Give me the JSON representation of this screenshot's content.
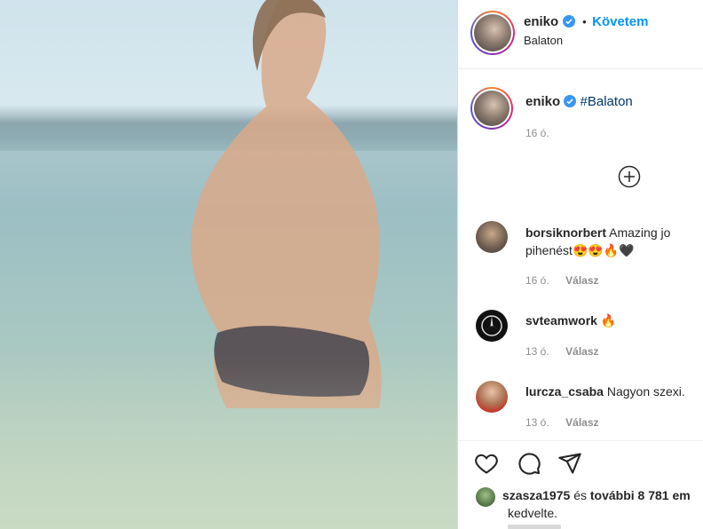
{
  "post": {
    "username": "eniko",
    "location": "Balaton",
    "follow_label": "Követem",
    "dot": "•"
  },
  "caption": {
    "username": "eniko",
    "hashtag": "#Balaton",
    "time": "16 ó."
  },
  "comments": [
    {
      "username": "borsiknorbert",
      "text_line1": "Amazing jo",
      "text_line2": "pihenést",
      "emojis": "😍😍🔥🖤",
      "time": "16 ó.",
      "reply": "Válasz"
    },
    {
      "username": "svteamwork",
      "text": "🔥",
      "time": "13 ó.",
      "reply": "Válasz"
    },
    {
      "username": "lurcza_csaba",
      "text": "Nagyon szexi.",
      "time": "13 ó.",
      "reply": "Válasz"
    }
  ],
  "likes": {
    "user": "szasza1975",
    "connector": "és",
    "others": "további 8 781 em",
    "suffix": "kedvelte."
  },
  "colors": {
    "accent": "#0095f6",
    "text": "#262626",
    "muted": "#8e8e8e",
    "verified": "#3897f0"
  },
  "icons": [
    "heart-icon",
    "comment-icon",
    "share-icon",
    "add-icon",
    "verified-icon"
  ]
}
